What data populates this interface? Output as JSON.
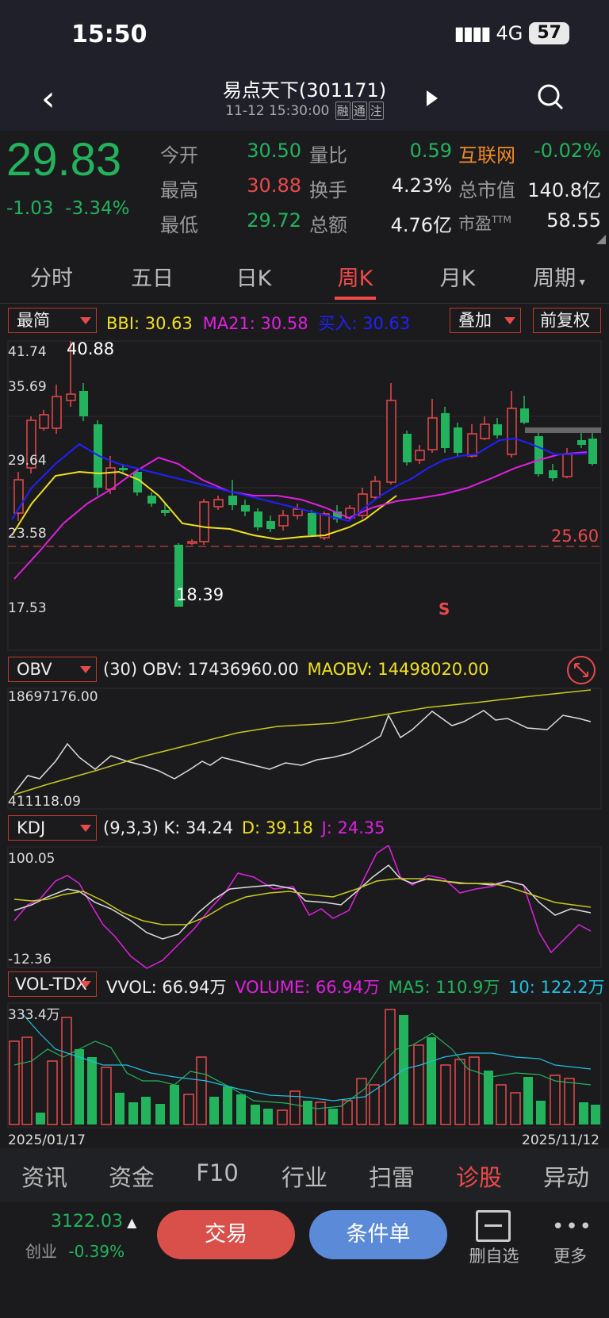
{
  "status": {
    "time": "15:50",
    "network": "4G",
    "battery": "57"
  },
  "header": {
    "title": "易点天下(301171)",
    "subtitle": "11-12 15:30:00",
    "tags": [
      "融",
      "通",
      "注"
    ]
  },
  "quote": {
    "price": "29.83",
    "change": "-1.03",
    "change_pct": "-3.34%",
    "rows": [
      {
        "l1": "今开",
        "v1": "30.50",
        "l2": "量比",
        "v2": "0.59",
        "l3": "互联网",
        "v3": "-0.02%"
      },
      {
        "l1": "最高",
        "v1": "30.88",
        "l2": "换手",
        "v2": "4.23%",
        "l3": "总市值",
        "v3": "140.8亿"
      },
      {
        "l1": "最低",
        "v1": "29.72",
        "l2": "总额",
        "v2": "4.76亿",
        "l3": "市盈",
        "l3sup": "TTM",
        "v3": "58.55"
      }
    ]
  },
  "tabs": [
    "分时",
    "五日",
    "日K",
    "周K",
    "月K",
    "周期"
  ],
  "main_ind": {
    "select": "最简",
    "bbi": "BBI: 30.63",
    "ma21": "MA21: 30.58",
    "buy": "买入: 30.63",
    "overlay": "叠加",
    "adjust": "前复权"
  },
  "price_chart": {
    "ymax": "41.74",
    "y2": "35.69",
    "y3": "29.64",
    "y4": "23.58",
    "ymin": "17.53",
    "high_label": "40.88",
    "low_label": "18.39",
    "line_label": "25.60",
    "signal": "S"
  },
  "obv": {
    "select": "OBV",
    "param": "(30)",
    "obv": "OBV: 17436960.00",
    "maobv": "MAOBV: 14498020.00",
    "ymax": "18697176.00",
    "ymin": "411118.09"
  },
  "kdj": {
    "select": "KDJ",
    "param": "(9,3,3)",
    "k": "K: 34.24",
    "d": "D: 39.18",
    "j": "J: 24.35",
    "ymax": "100.05",
    "ymin": "-12.36"
  },
  "vol": {
    "select": "VOL-TDX",
    "vvol": "VVOL: 66.94万",
    "volume": "VOLUME: 66.94万",
    "ma5": "MA5: 110.9万",
    "ma10": "10: 122.2万",
    "ymax": "333.4万",
    "date_start": "2025/01/17",
    "date_end": "2025/11/12"
  },
  "bottom_tabs": [
    "资讯",
    "资金",
    "F10",
    "行业",
    "扫雷",
    "诊股",
    "异动"
  ],
  "footer": {
    "index_value": "3122.03",
    "index_name": "创业",
    "index_chg": "-0.39%",
    "trade": "交易",
    "condition": "条件单",
    "delete": "删自选",
    "more": "更多"
  },
  "colors": {
    "up": "#e84a4a",
    "down": "#22b35c",
    "bbi": "#f0e020",
    "ma21": "#e020e0",
    "buy": "#2020ff",
    "accent": "#f04a4a"
  }
}
